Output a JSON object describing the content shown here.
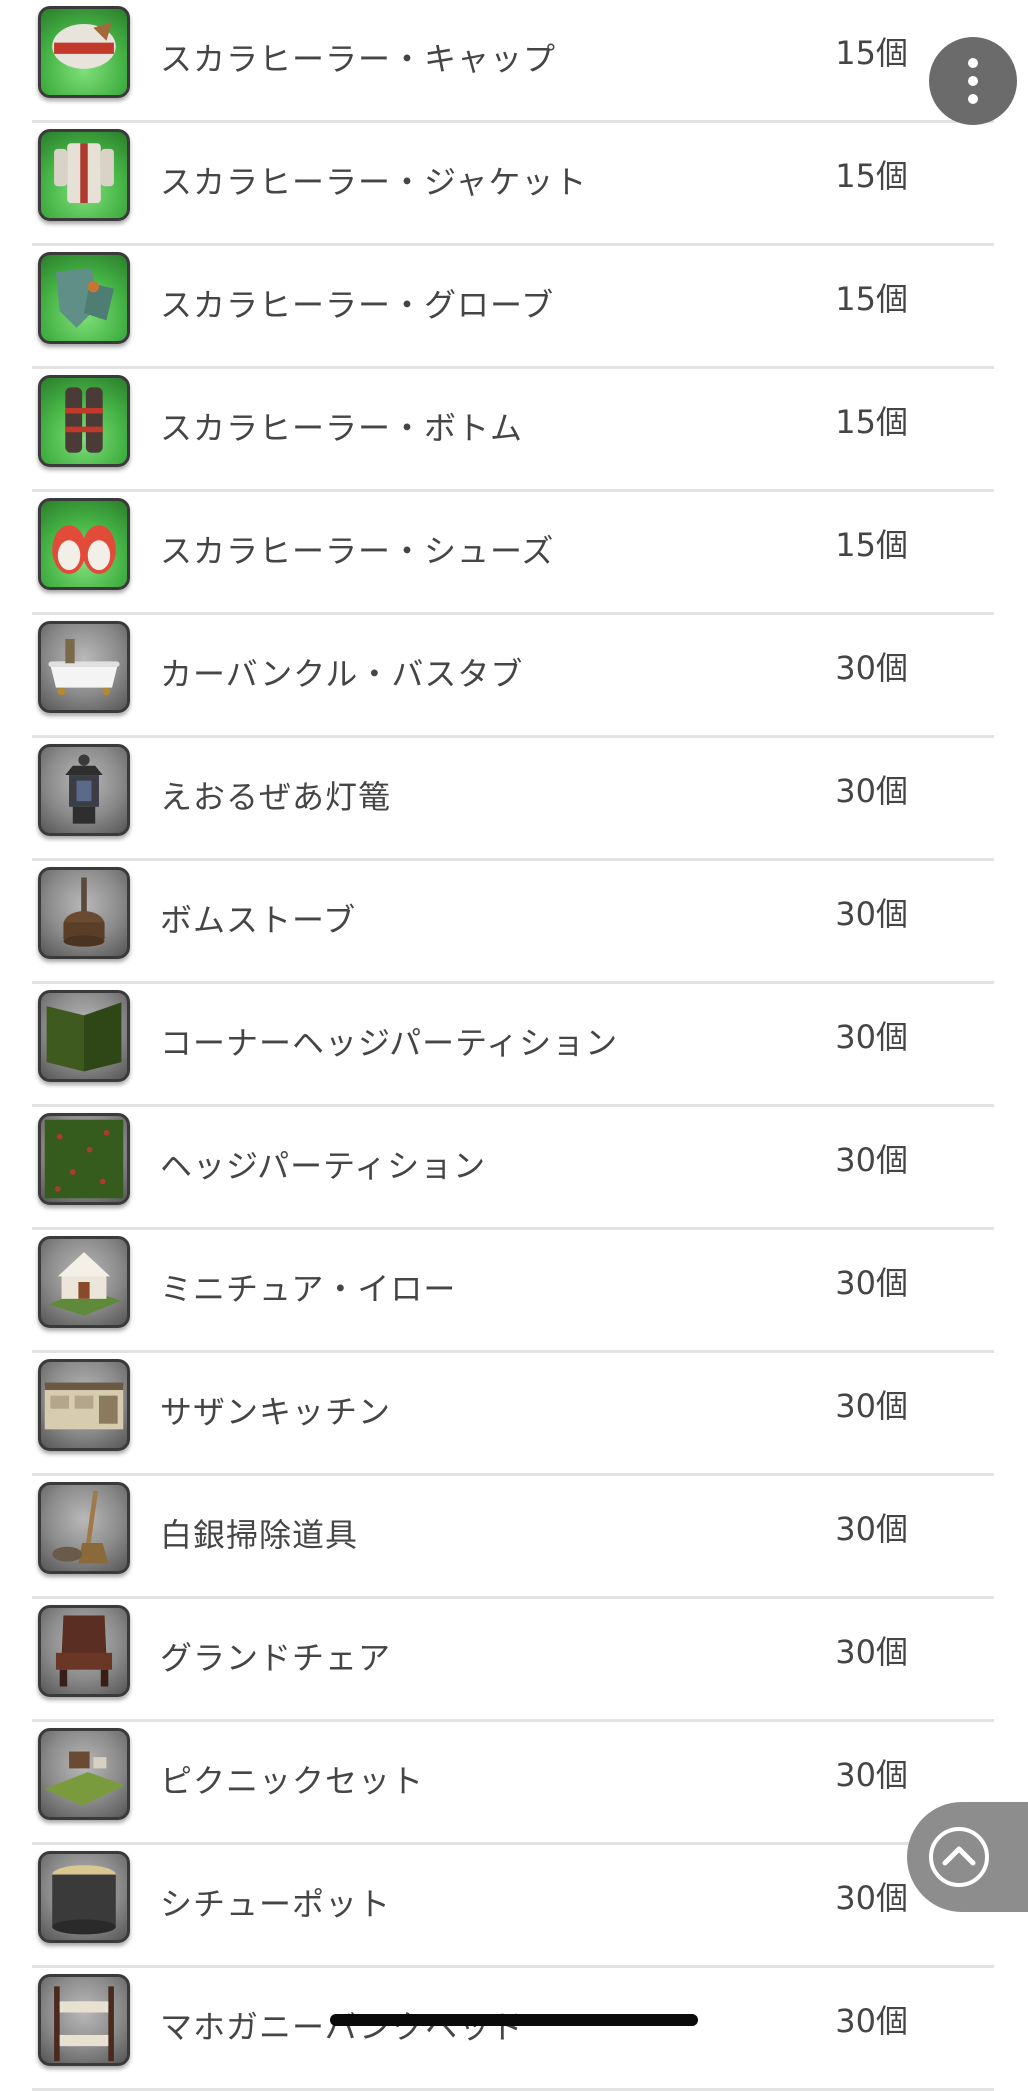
{
  "items": [
    {
      "name": "スカラヒーラー・キャップ",
      "quantity": "15個",
      "icon": "scholar-cap-icon"
    },
    {
      "name": "スカラヒーラー・ジャケット",
      "quantity": "15個",
      "icon": "scholar-jacket-icon"
    },
    {
      "name": "スカラヒーラー・グローブ",
      "quantity": "15個",
      "icon": "scholar-gloves-icon"
    },
    {
      "name": "スカラヒーラー・ボトム",
      "quantity": "15個",
      "icon": "scholar-bottoms-icon"
    },
    {
      "name": "スカラヒーラー・シューズ",
      "quantity": "15個",
      "icon": "scholar-shoes-icon"
    },
    {
      "name": "カーバンクル・バスタブ",
      "quantity": "30個",
      "icon": "bathtub-icon"
    },
    {
      "name": "えおるぜあ灯篭",
      "quantity": "30個",
      "icon": "lantern-icon"
    },
    {
      "name": "ボムストーブ",
      "quantity": "30個",
      "icon": "stove-icon"
    },
    {
      "name": "コーナーヘッジパーティション",
      "quantity": "30個",
      "icon": "corner-hedge-icon"
    },
    {
      "name": "ヘッジパーティション",
      "quantity": "30個",
      "icon": "hedge-icon"
    },
    {
      "name": "ミニチュア・イロー",
      "quantity": "30個",
      "icon": "miniature-yurt-icon"
    },
    {
      "name": "サザンキッチン",
      "quantity": "30個",
      "icon": "kitchen-icon"
    },
    {
      "name": "白銀掃除道具",
      "quantity": "30個",
      "icon": "broom-icon"
    },
    {
      "name": "グランドチェア",
      "quantity": "30個",
      "icon": "chair-icon"
    },
    {
      "name": "ピクニックセット",
      "quantity": "30個",
      "icon": "picnic-set-icon"
    },
    {
      "name": "シチューポット",
      "quantity": "30個",
      "icon": "stew-pot-icon"
    },
    {
      "name": "マホガニーバンクベッド",
      "quantity": "30個",
      "icon": "bunk-bed-icon"
    }
  ],
  "controls": {
    "more_icon": "more-vertical-icon",
    "scroll_top_icon": "chevron-up-icon"
  }
}
